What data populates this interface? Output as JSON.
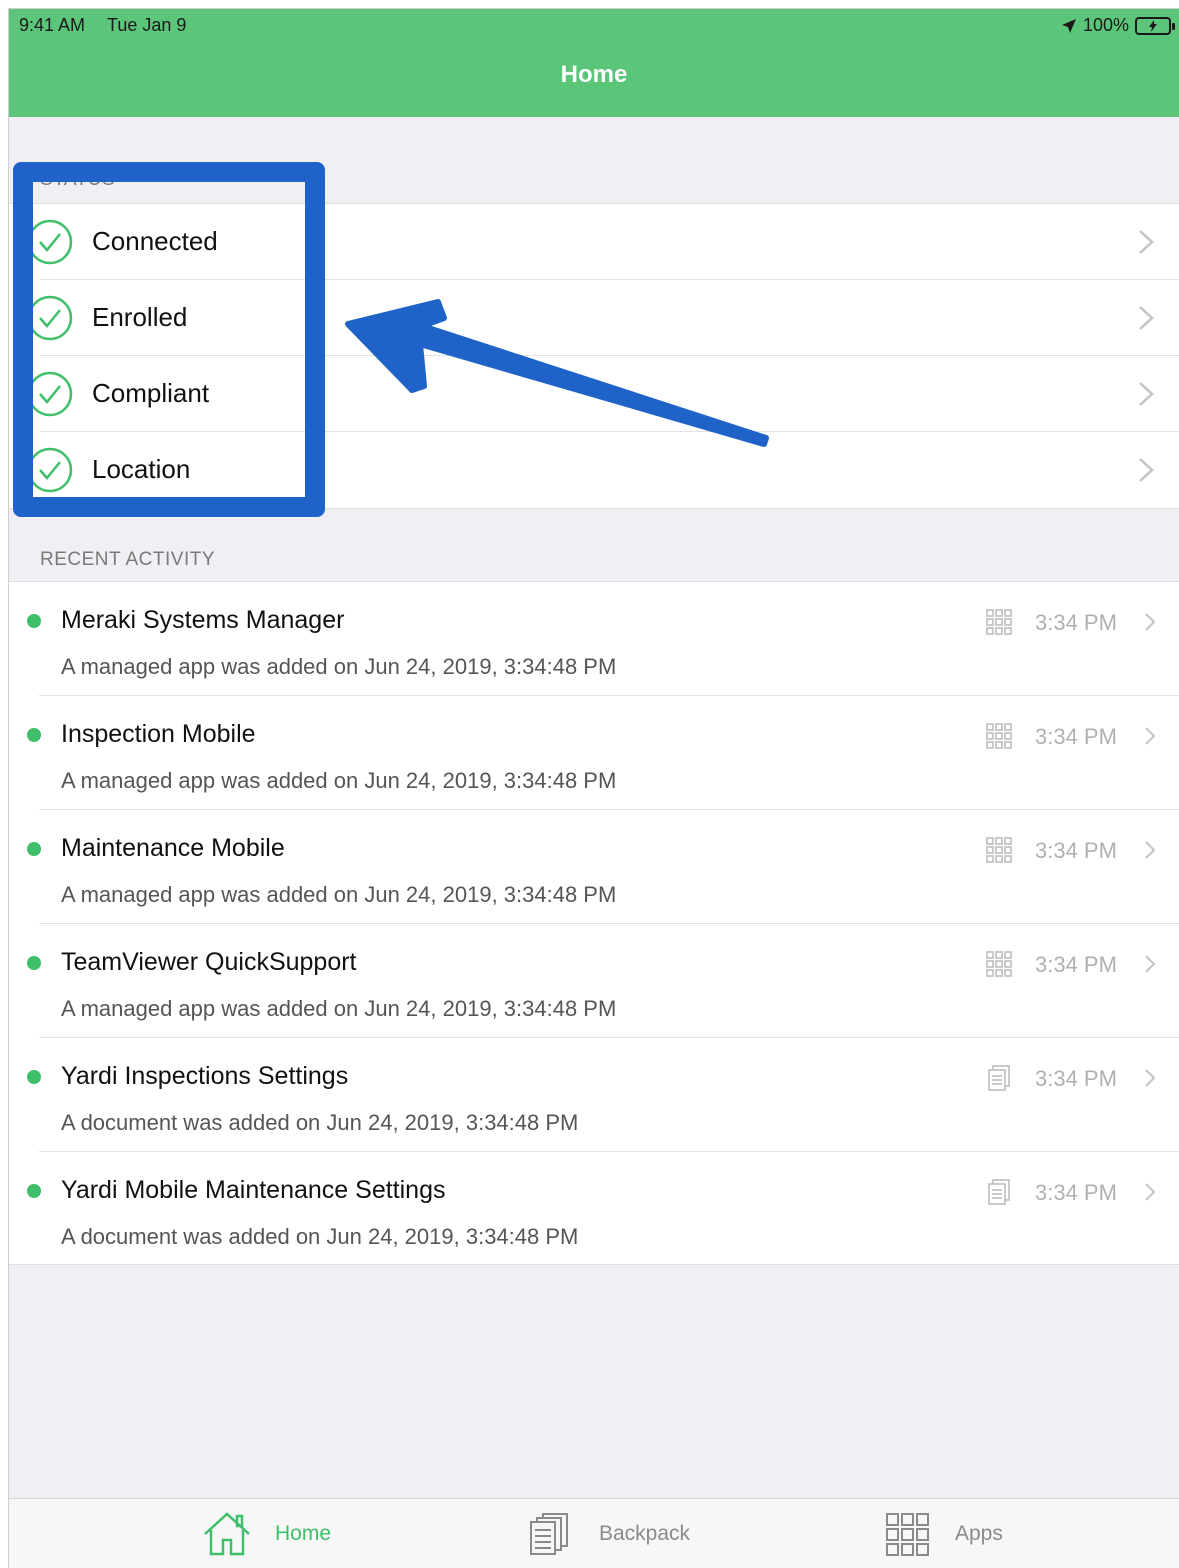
{
  "status_bar": {
    "time": "9:41 AM",
    "date": "Tue Jan 9",
    "battery": "100%"
  },
  "header": {
    "title": "Home"
  },
  "status_section": {
    "label": "STATUS",
    "items": [
      {
        "label": "Connected"
      },
      {
        "label": "Enrolled"
      },
      {
        "label": "Compliant"
      },
      {
        "label": "Location"
      }
    ]
  },
  "activity_section": {
    "label": "RECENT ACTIVITY",
    "items": [
      {
        "title": "Meraki Systems Manager",
        "description": "A managed app was added on Jun 24, 2019, 3:34:48 PM",
        "time": "3:34 PM",
        "icon": "apps-grid-icon"
      },
      {
        "title": "Inspection Mobile",
        "description": "A managed app was added on Jun 24, 2019, 3:34:48 PM",
        "time": "3:34 PM",
        "icon": "apps-grid-icon"
      },
      {
        "title": "Maintenance Mobile",
        "description": "A managed app was added on Jun 24, 2019, 3:34:48 PM",
        "time": "3:34 PM",
        "icon": "apps-grid-icon"
      },
      {
        "title": "TeamViewer QuickSupport",
        "description": "A managed app was added on Jun 24, 2019, 3:34:48 PM",
        "time": "3:34 PM",
        "icon": "apps-grid-icon"
      },
      {
        "title": "Yardi Inspections Settings",
        "description": "A document was added on Jun 24, 2019, 3:34:48 PM",
        "time": "3:34 PM",
        "icon": "document-icon"
      },
      {
        "title": "Yardi Mobile Maintenance Settings",
        "description": "A document was added on Jun 24, 2019, 3:34:48 PM",
        "time": "3:34 PM",
        "icon": "document-icon"
      }
    ]
  },
  "tabbar": {
    "tabs": [
      {
        "label": "Home",
        "icon": "house-icon",
        "active": true
      },
      {
        "label": "Backpack",
        "icon": "documents-icon",
        "active": false
      },
      {
        "label": "Apps",
        "icon": "apps-grid-icon",
        "active": false
      }
    ]
  },
  "colors": {
    "accent": "#5bc57a",
    "annotation": "#1f63c8",
    "status_dot": "#3fbf6a"
  }
}
